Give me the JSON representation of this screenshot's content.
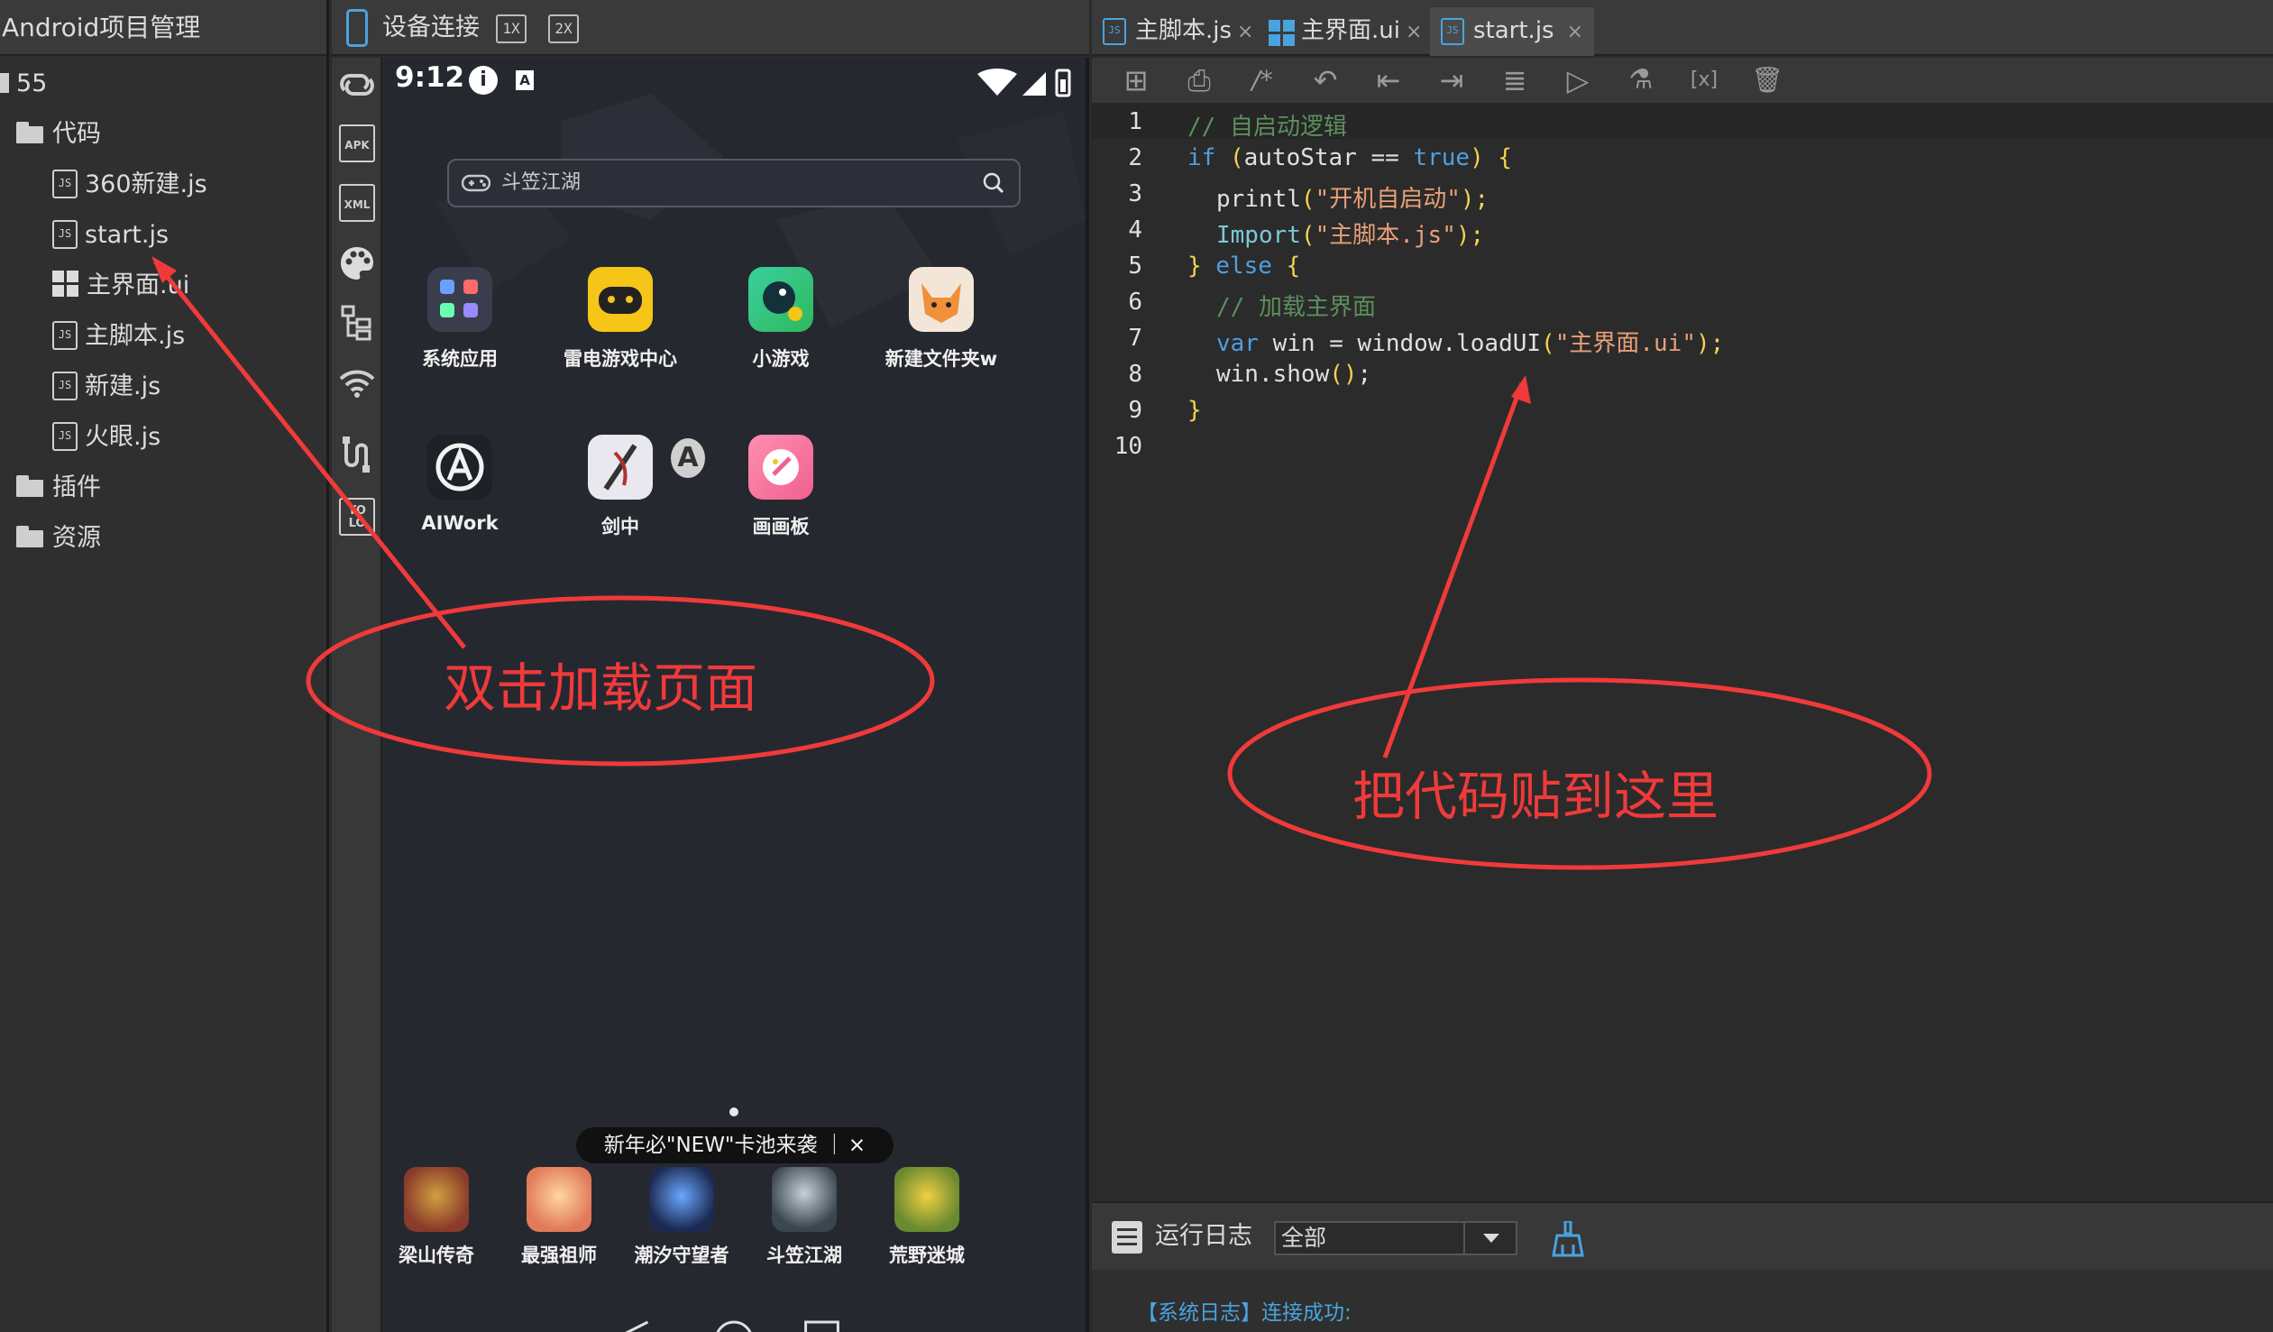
{
  "project": {
    "title": "Android项目管理",
    "root": "55",
    "folders": {
      "code": "代码",
      "plugins": "插件",
      "resources": "资源"
    },
    "files": [
      "360新建.js",
      "start.js",
      "主界面.ui",
      "主脚本.js",
      "新建.js",
      "火眼.js"
    ]
  },
  "device": {
    "title": "设备连接",
    "zoom": [
      "1X",
      "2X"
    ],
    "toolbar_icons": [
      "link-icon",
      "apk-icon",
      "xml-icon",
      "palette-icon",
      "tree-icon",
      "wifi-icon",
      "usb-icon",
      "yolo-icon"
    ],
    "apk_text": "APK",
    "xml_text": "XML",
    "yolo_text": "YO LO"
  },
  "phone": {
    "time": "9:12",
    "info_glyph": "i",
    "a_glyph": "A",
    "search_text": "斗笠江湖",
    "apps": [
      {
        "label": "系统应用",
        "color": "#2f3340"
      },
      {
        "label": "雷电游戏中心",
        "color": "#f5c518"
      },
      {
        "label": "小游戏",
        "color": "#3ccf7a"
      },
      {
        "label": "新建文件夹w",
        "color": "#f0a060"
      },
      {
        "label": "AIWork",
        "color": "#1f2128"
      },
      {
        "label": "剑中",
        "color": "#e8e8ee"
      },
      {
        "label": "画画板",
        "color": "#f07aa0"
      }
    ],
    "banner": "新年必\"NEW\"卡池来袭 ｜",
    "banner_close": "×",
    "dock": [
      {
        "label": "梁山传奇",
        "color": "#8a3b2a"
      },
      {
        "label": "最强祖师",
        "color": "#e89a6a"
      },
      {
        "label": "潮汐守望者",
        "color": "#1c2a52"
      },
      {
        "label": "斗笠江湖",
        "color": "#4a5a66"
      },
      {
        "label": "荒野迷城",
        "color": "#8aa040"
      }
    ]
  },
  "editor": {
    "tabs": [
      {
        "label": "主脚本.js",
        "close": "×",
        "icon": "js-file-icon"
      },
      {
        "label": "主界面.ui",
        "close": "×",
        "icon": "ui-grid-icon"
      },
      {
        "label": "start.js",
        "close": "×",
        "icon": "js-file-icon"
      }
    ],
    "active_tab": "start.js",
    "toolbar": [
      "add-icon",
      "print-icon",
      "comment-icon",
      "undo-icon",
      "outdent-icon",
      "indent-icon",
      "format-icon",
      "run-icon",
      "test-icon",
      "variable-icon",
      "clear-icon"
    ],
    "toolbar_glyphs": [
      "⊞",
      "⎙",
      "/*",
      "↶",
      "⇤",
      "⇥",
      "≣",
      "▷",
      "⚗",
      "[x]",
      "🗑"
    ],
    "line_numbers": [
      "1",
      "2",
      "3",
      "4",
      "5",
      "6",
      "7",
      "8",
      "9",
      "10"
    ],
    "code": {
      "l1": "// 自启动逻辑",
      "l2_kw": "if",
      "l2_open": " (",
      "l2_var": "autoStar == ",
      "l2_true": "true",
      "l2_close": ") ",
      "l2_brace": "{",
      "l3_fn": "printl",
      "l3_open": "(",
      "l3_str": "\"开机自启动\"",
      "l3_close": ");",
      "l4_fn": "Import",
      "l4_open": "(",
      "l4_str": "\"主脚本.js\"",
      "l4_close": ");",
      "l5_brace": "}",
      "l5_kw": " else ",
      "l5_brace2": "{",
      "l6": "// 加载主界面",
      "l7_kw": "var",
      "l7_mid": " win = window.loadUI",
      "l7_open": "(",
      "l7_str": "\"主界面.ui\"",
      "l7_close": ");",
      "l8_a": "win.show",
      "l8_b": "()",
      "l8_c": ";",
      "l9": "}"
    }
  },
  "log": {
    "title": "运行日志",
    "filter": "全部",
    "line": "【系统日志】连接成功:"
  },
  "annotations": {
    "left": "双击加载页面",
    "right": "把代码贴到这里"
  },
  "colors": {
    "accent_blue": "#4aa3df",
    "annotation_red": "#f03a3a",
    "comment_green": "#5c8f5c",
    "keyword_blue": "#4f9fe0",
    "string_orange": "#e8a07a"
  }
}
